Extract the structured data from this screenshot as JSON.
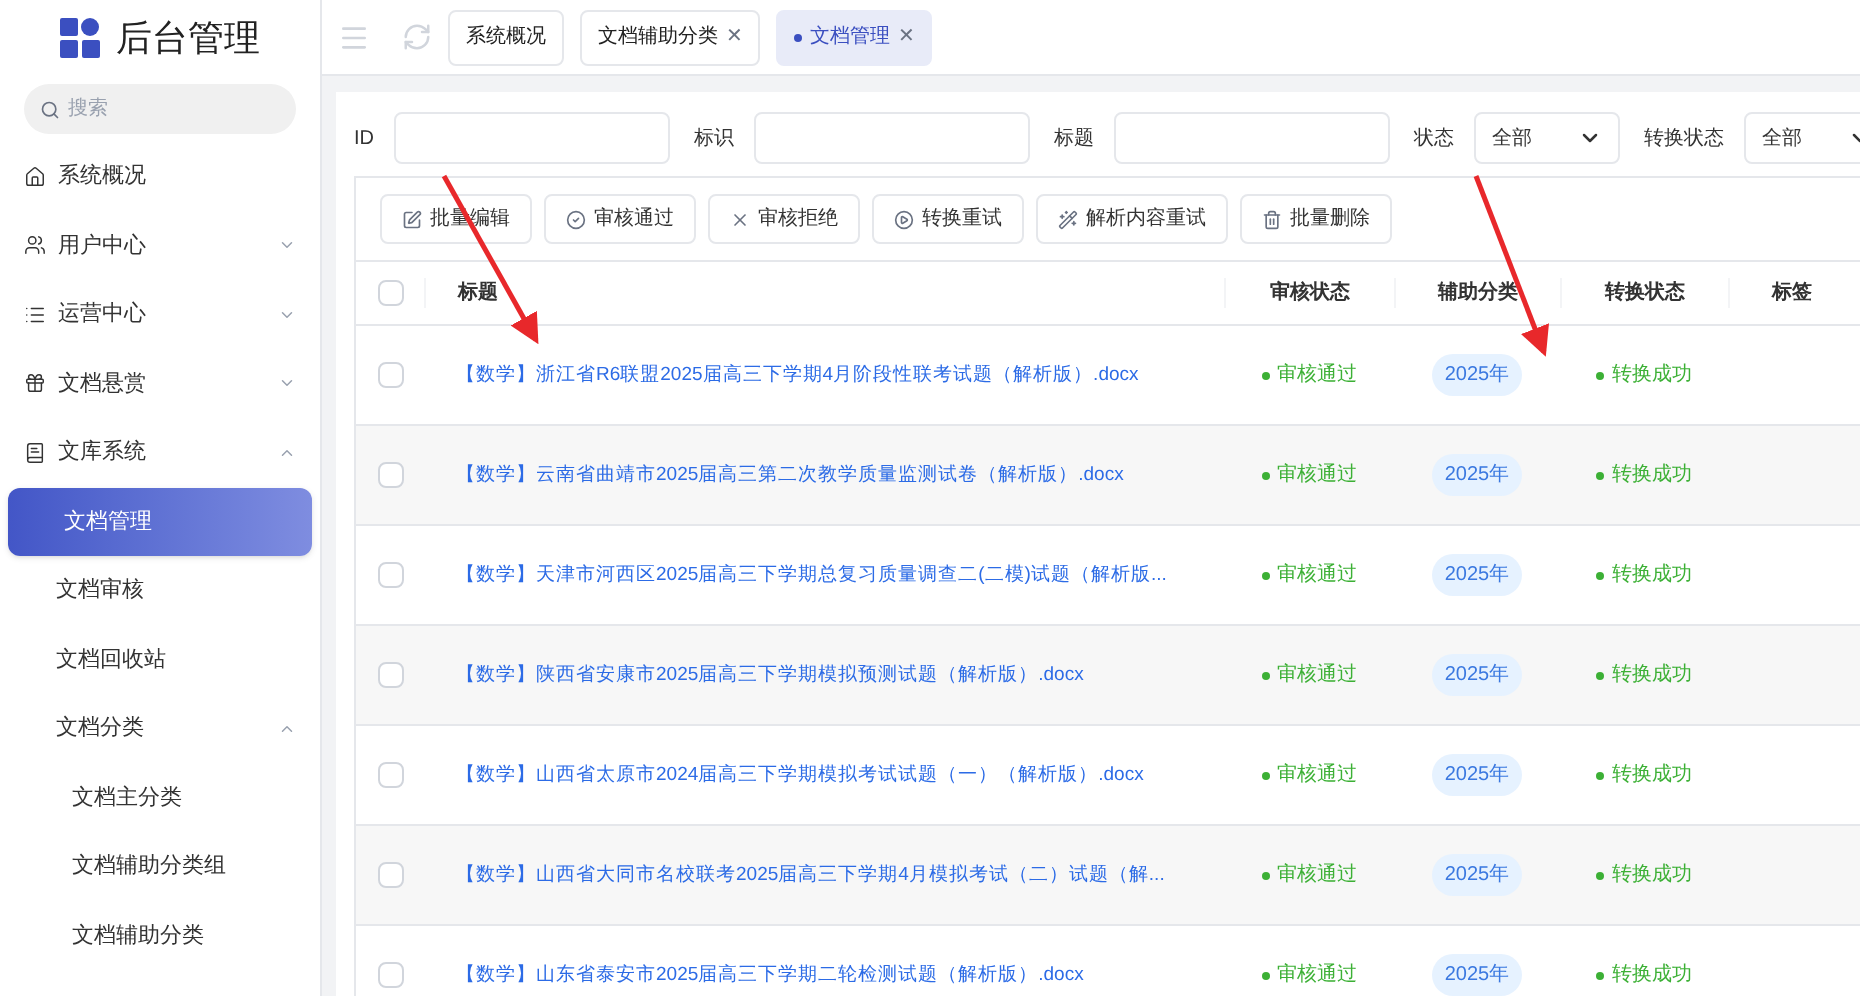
{
  "sidebar": {
    "title": "后台管理",
    "search": {
      "placeholder": "搜索"
    },
    "items": [
      {
        "label": "系统概况",
        "selected": false
      },
      {
        "label": "用户中心",
        "expanded": false,
        "selected": false
      },
      {
        "label": "运营中心",
        "expanded": false,
        "selected": false
      },
      {
        "label": "文档悬赏",
        "expanded": false,
        "selected": false
      },
      {
        "label": "文库系统",
        "expanded": true,
        "selected": false,
        "children": [
          {
            "label": "文档管理",
            "selected": true
          },
          {
            "label": "文档审核",
            "selected": false
          },
          {
            "label": "文档回收站",
            "selected": false
          },
          {
            "label": "文档分类",
            "selected": false,
            "expanded": true,
            "children": [
              {
                "label": "文档主分类",
                "selected": false
              },
              {
                "label": "文档辅助分类组",
                "selected": false
              },
              {
                "label": "文档辅助分类",
                "selected": false
              }
            ]
          }
        ]
      }
    ]
  },
  "tabs": [
    {
      "label": "系统概况",
      "selected": false,
      "closable": false
    },
    {
      "label": "文档辅助分类",
      "selected": false,
      "closable": true
    },
    {
      "label": "文档管理",
      "selected": true,
      "closable": true
    }
  ],
  "close_glyph": "✕",
  "filters": [
    {
      "label": "ID",
      "kind": "input"
    },
    {
      "label": "标识",
      "kind": "input"
    },
    {
      "label": "标题",
      "kind": "input"
    },
    {
      "label": "状态",
      "kind": "select",
      "value": "全部"
    },
    {
      "label": "转换状态",
      "kind": "select",
      "value": "全部"
    }
  ],
  "toolbar": [
    {
      "label": "批量编辑"
    },
    {
      "label": "审核通过"
    },
    {
      "label": "审核拒绝"
    },
    {
      "label": "转换重试"
    },
    {
      "label": "解析内容重试"
    },
    {
      "label": "批量删除"
    }
  ],
  "table": {
    "all_checked": false,
    "columns": [
      "标题",
      "审核状态",
      "辅助分类",
      "转换状态",
      "标签"
    ],
    "rows": [
      {
        "checked": false,
        "title": "【数学】浙江省R6联盟2025届高三下学期4月阶段性联考试题（解析版）.docx",
        "review": "审核通过",
        "category": "2025年",
        "convert": "转换成功"
      },
      {
        "checked": false,
        "title": "【数学】云南省曲靖市2025届高三第二次教学质量监测试卷（解析版）.docx",
        "review": "审核通过",
        "category": "2025年",
        "convert": "转换成功"
      },
      {
        "checked": false,
        "title": "【数学】天津市河西区2025届高三下学期总复习质量调查二(二模)试题（解析版...",
        "review": "审核通过",
        "category": "2025年",
        "convert": "转换成功"
      },
      {
        "checked": false,
        "title": "【数学】陕西省安康市2025届高三下学期模拟预测试题（解析版）.docx",
        "review": "审核通过",
        "category": "2025年",
        "convert": "转换成功"
      },
      {
        "checked": false,
        "title": "【数学】山西省太原市2024届高三下学期模拟考试试题（一）（解析版）.docx",
        "review": "审核通过",
        "category": "2025年",
        "convert": "转换成功"
      },
      {
        "checked": false,
        "title": "【数学】山西省大同市名校联考2025届高三下学期4月模拟考试（二）试题（解...",
        "review": "审核通过",
        "category": "2025年",
        "convert": "转换成功"
      },
      {
        "checked": false,
        "title": "【数学】山东省泰安市2025届高三下学期二轮检测试题（解析版）.docx",
        "review": "审核通过",
        "category": "2025年",
        "convert": "转换成功"
      }
    ]
  }
}
